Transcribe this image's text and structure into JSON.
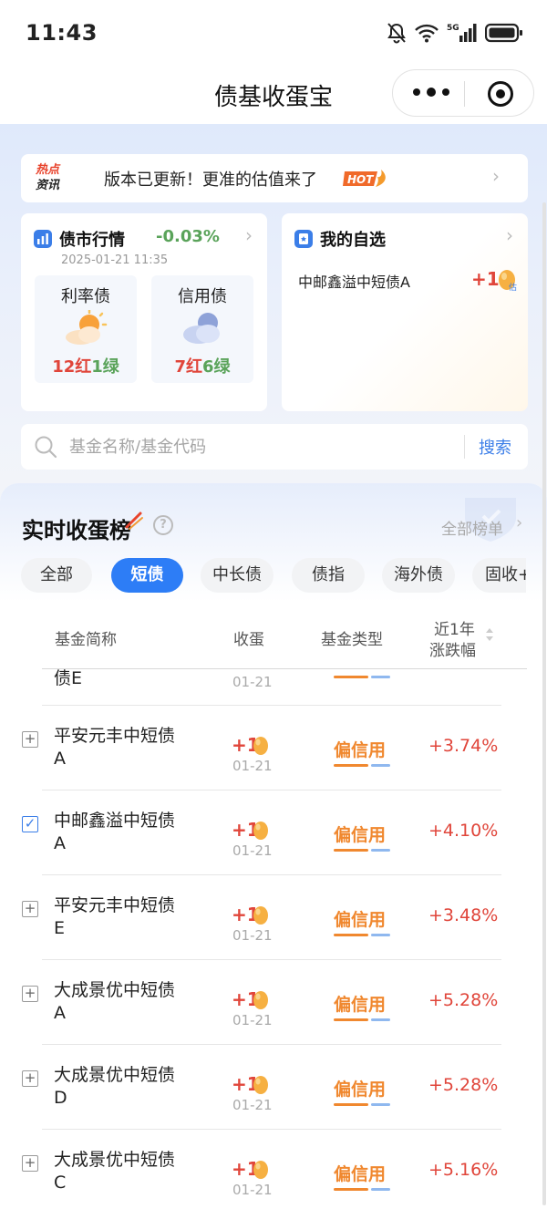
{
  "status": {
    "time": "11:43",
    "network": "5G"
  },
  "nav": {
    "title": "债基收蛋宝"
  },
  "news": {
    "badge_line1": "热点",
    "badge_line2": "资讯",
    "text": "版本已更新！更准的估值来了",
    "hot_label": "HOT"
  },
  "market": {
    "title": "债市行情",
    "change": "-0.03%",
    "date": "2025-01-21 11:35",
    "rate_bond": {
      "label": "利率债",
      "red": "12红",
      "green": "1绿",
      "weather": "sunny-icon"
    },
    "credit_bond": {
      "label": "信用债",
      "red": "7红",
      "green": "6绿",
      "weather": "cloudy-icon"
    }
  },
  "watchlist": {
    "title": "我的自选",
    "item_name": "中邮鑫溢中短债A",
    "item_value": "+1",
    "egg_badge": "估"
  },
  "search": {
    "placeholder": "基金名称/基金代码",
    "button": "搜索"
  },
  "ranking": {
    "title": "实时收蛋榜",
    "help": "?",
    "all_link": "全部榜单",
    "tabs": [
      {
        "label": "全部",
        "active": false
      },
      {
        "label": "短债",
        "active": true
      },
      {
        "label": "中长债",
        "active": false
      },
      {
        "label": "债指",
        "active": false
      },
      {
        "label": "海外债",
        "active": false
      },
      {
        "label": "固收+",
        "active": false
      }
    ],
    "columns": {
      "name": "基金简称",
      "egg": "收蛋",
      "type": "基金类型",
      "change_l1": "近1年",
      "change_l2": "涨跌幅"
    },
    "partial_row": {
      "name_tail": "债E",
      "egg_date": "01-21"
    },
    "rows": [
      {
        "name": "平安元丰中短债A",
        "checked": false,
        "egg": "+1",
        "date": "01-21",
        "type": "偏信用",
        "change": "+3.74%"
      },
      {
        "name": "中邮鑫溢中短债A",
        "checked": true,
        "egg": "+1",
        "date": "01-21",
        "type": "偏信用",
        "change": "+4.10%"
      },
      {
        "name": "平安元丰中短债E",
        "checked": false,
        "egg": "+1",
        "date": "01-21",
        "type": "偏信用",
        "change": "+3.48%"
      },
      {
        "name": "大成景优中短债A",
        "checked": false,
        "egg": "+1",
        "date": "01-21",
        "type": "偏信用",
        "change": "+5.28%"
      },
      {
        "name": "大成景优中短债D",
        "checked": false,
        "egg": "+1",
        "date": "01-21",
        "type": "偏信用",
        "change": "+5.28%"
      },
      {
        "name": "大成景优中短债C",
        "checked": false,
        "egg": "+1",
        "date": "01-21",
        "type": "偏信用",
        "change": "+5.16%"
      }
    ]
  },
  "colors": {
    "accent": "#2d7df6",
    "up": "#e0453a",
    "down": "#5aa35a",
    "type_orange": "#f0882f"
  }
}
